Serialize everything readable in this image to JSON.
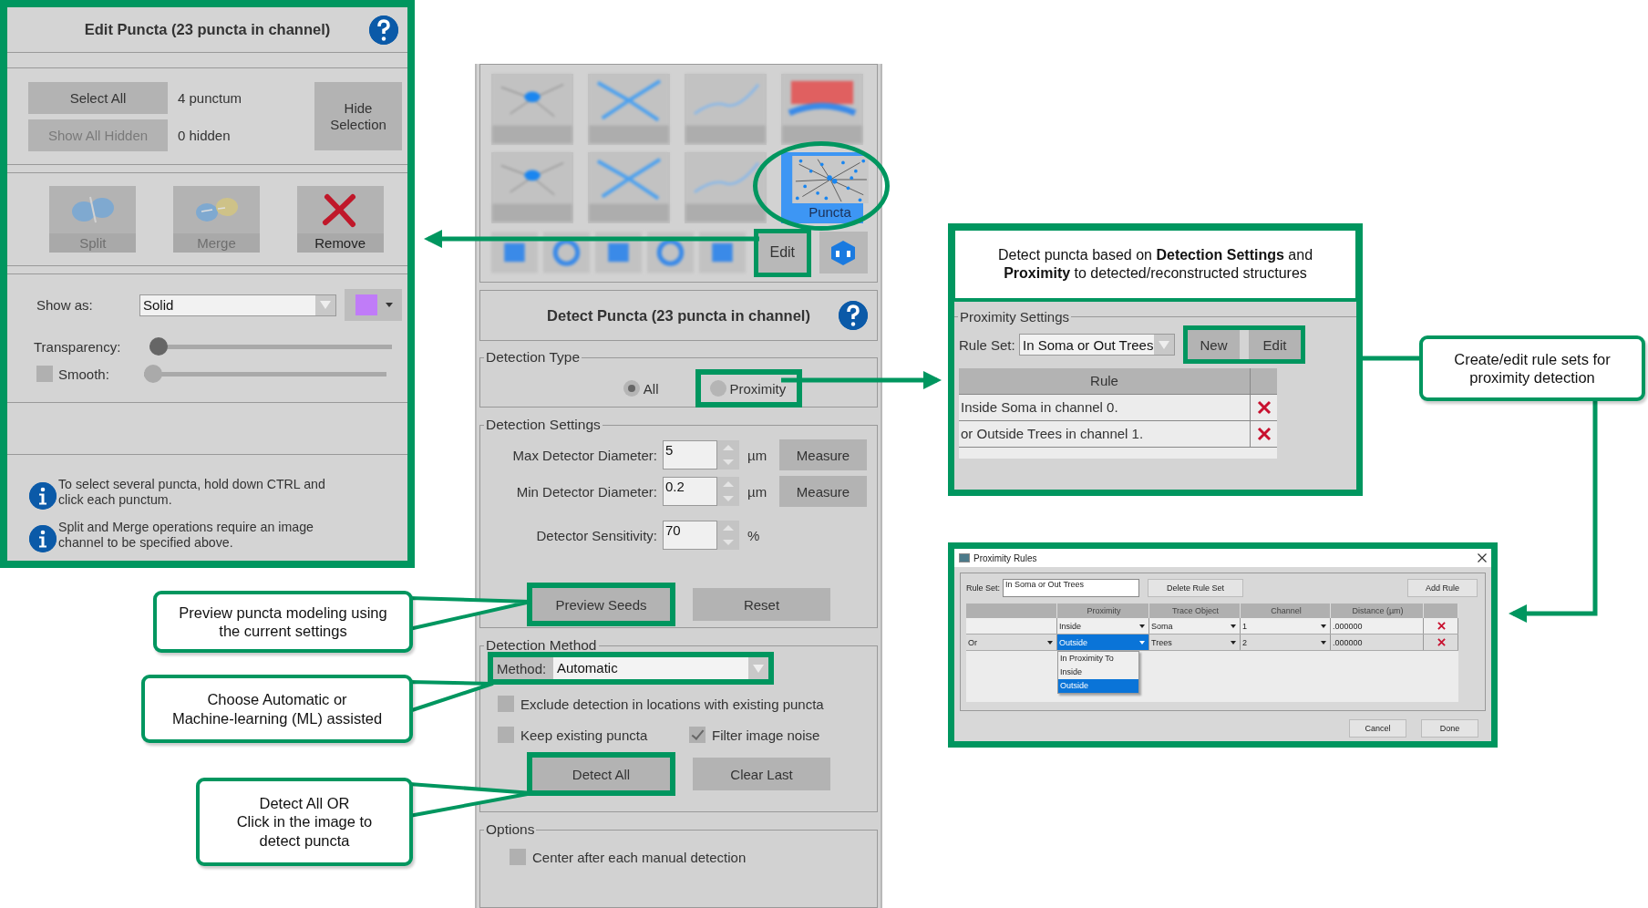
{
  "edit_panel": {
    "title": "Edit Puncta (23 puncta in channel)",
    "select_all": {
      "label": "Select All",
      "disabled": false
    },
    "punctum_count": "4 punctum",
    "show_all_hidden": {
      "label": "Show All Hidden",
      "disabled": true
    },
    "hidden_count": "0 hidden",
    "hide_selection": {
      "label": "Hide Selection",
      "disabled": false
    },
    "actions": [
      {
        "kind": "split",
        "label": "Split",
        "disabled": true
      },
      {
        "kind": "merge",
        "label": "Merge",
        "disabled": true
      },
      {
        "kind": "remove",
        "label": "Remove",
        "disabled": false
      }
    ],
    "show_as": {
      "label": "Show as:",
      "value": "Solid",
      "color": "#c07cf8"
    },
    "transparency": {
      "label": "Transparency:",
      "level": 0,
      "disabled": false
    },
    "smooth": {
      "label": "Smooth:",
      "checked": false,
      "level": 0,
      "disabled": true
    },
    "tips": [
      "To select several puncta, hold down CTRL and click each punctum.",
      "Split and Merge operations require an image channel to be specified above."
    ]
  },
  "tool_palette": {
    "tiles": [
      {
        "kind": "blurred",
        "selected": false
      },
      {
        "kind": "blurred",
        "selected": false
      },
      {
        "kind": "blurred",
        "selected": false
      },
      {
        "kind": "blurred",
        "selected": false
      },
      {
        "kind": "blurred",
        "selected": false
      },
      {
        "kind": "blurred",
        "selected": false
      },
      {
        "kind": "blurred",
        "selected": false
      },
      {
        "kind": "puncta",
        "label": "Puncta",
        "selected": true
      }
    ],
    "edit": "Edit"
  },
  "detect_panel": {
    "title": "Detect Puncta (23 puncta in channel)",
    "detection_type": {
      "legend": "Detection Type",
      "options": [
        {
          "label": "All",
          "selected": true
        },
        {
          "label": "Proximity",
          "selected": false
        }
      ]
    },
    "detection_settings": {
      "legend": "Detection Settings",
      "fields": [
        {
          "label": "Max Detector Diameter:",
          "value": "5",
          "unit": "µm",
          "button": "Measure"
        },
        {
          "label": "Min Detector Diameter:",
          "value": "0.2",
          "unit": "µm",
          "button": "Measure"
        },
        {
          "label": "Detector Sensitivity:",
          "value": "70",
          "unit": "%"
        }
      ],
      "preview_seeds": "Preview Seeds",
      "reset": "Reset"
    },
    "detection_method": {
      "legend": "Detection Method",
      "method_label": "Method:",
      "method_value": "Automatic",
      "checkboxes": [
        {
          "label": "Exclude detection in locations with existing puncta",
          "checked": false
        },
        {
          "label": "Keep existing puncta",
          "checked": false
        },
        {
          "label": "Filter image noise",
          "checked": true
        }
      ],
      "detect_all": "Detect All",
      "clear_last": "Clear Last"
    },
    "options": {
      "legend": "Options",
      "checkboxes": [
        {
          "label": "Center after each manual detection",
          "checked": false
        }
      ]
    }
  },
  "proximity_panel": {
    "note": "Detect puncta based on **Detection Settings** and **Proximity** to detected/reconstructed structures",
    "legend": "Proximity Settings",
    "rule_set_label": "Rule Set:",
    "rule_set_value": "In Soma or Out Trees",
    "new": "New",
    "edit": "Edit",
    "column": "Rule",
    "rules": [
      "Inside Soma in channel 0.",
      "or Outside Trees in channel 1."
    ]
  },
  "proximity_rules_dialog": {
    "title": "Proximity Rules",
    "rule_set_label": "Rule Set:",
    "rule_set_value": "In Soma or Out Trees",
    "delete_rule_set": "Delete Rule Set",
    "add_rule": "Add Rule",
    "columns": [
      "Proximity",
      "Trace Object",
      "Channel",
      "Distance (µm)"
    ],
    "rows": [
      {
        "conjunction": "",
        "proximity": "Inside",
        "trace_object": "Soma",
        "channel": "1",
        "distance": ".000000",
        "selected": false
      },
      {
        "conjunction": "Or",
        "proximity": "Outside",
        "trace_object": "Trees",
        "channel": "2",
        "distance": ".000000",
        "selected": true
      }
    ],
    "dropdown_options": [
      {
        "label": "In Proximity To",
        "selected": false
      },
      {
        "label": "Inside",
        "selected": false
      },
      {
        "label": "Outside",
        "selected": true
      }
    ],
    "cancel": "Cancel",
    "done": "Done"
  },
  "callouts": [
    {
      "text": "Preview puncta modeling using\nthe current settings"
    },
    {
      "text": "Choose Automatic or\nMachine-learning (ML) assisted"
    },
    {
      "text": "Detect All  OR\nClick in the image to\ndetect puncta"
    },
    {
      "text": "Create/edit rule sets for\nproximity detection"
    }
  ]
}
